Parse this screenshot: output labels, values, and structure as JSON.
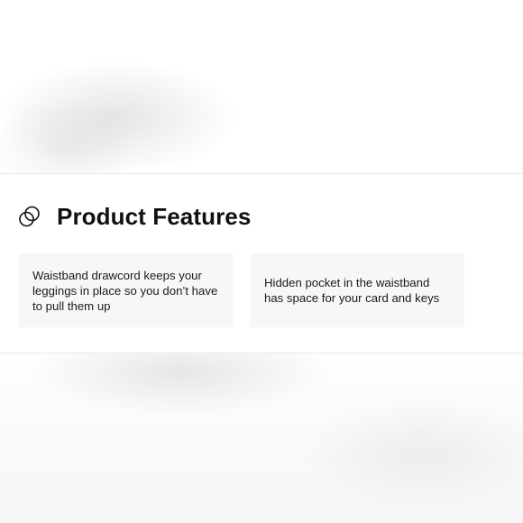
{
  "section": {
    "title": "Product Features",
    "icon": "overlapping-circles-icon"
  },
  "features": [
    {
      "text": "Waistband drawcord keeps your leggings in place so you don’t have to pull them up"
    },
    {
      "text": "Hidden pocket in the waistband has space for your card and keys"
    }
  ]
}
